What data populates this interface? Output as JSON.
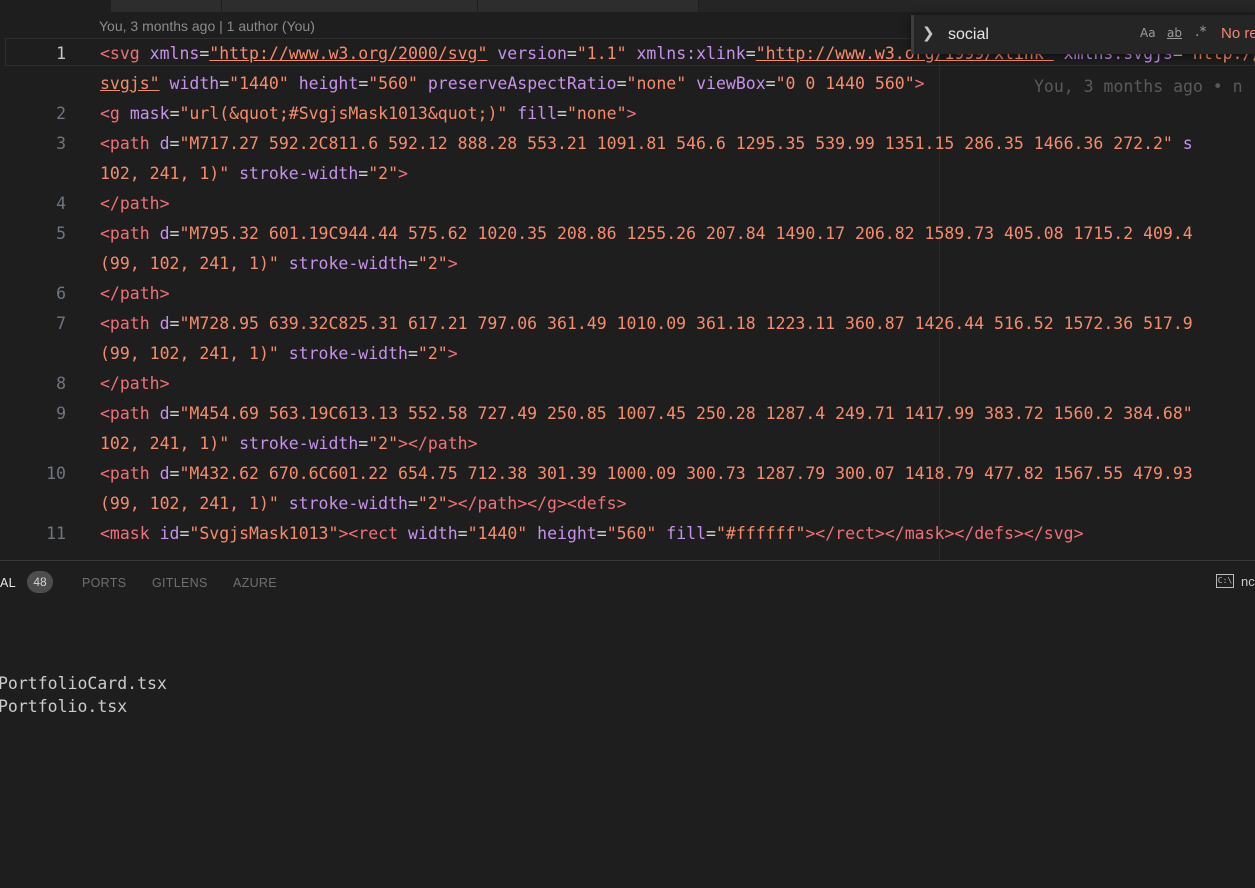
{
  "codelens": "You, 3 months ago | 1 author (You)",
  "blame": "You, 3 months ago • n",
  "line_numbers": [
    "1",
    "2",
    "3",
    "4",
    "5",
    "6",
    "7",
    "8",
    "9",
    "10",
    "11"
  ],
  "code": {
    "l1a": {
      "t1": "<svg ",
      "a1": "xmlns",
      "e1": "=",
      "s1": "\"http://www.w3.org/2000/svg\"",
      "a2": " version",
      "e2": "=",
      "s2": "\"1.1\"",
      "a3": " xmlns:xlink",
      "e3": "=",
      "s3": "\"http://www.w3.org/1999/xlink\"",
      "a4": " xmlns:svgjs",
      "e4": "=",
      "s4": "\"http://"
    },
    "l1b": {
      "s1": "svgjs\"",
      "a1": " width",
      "e1": "=",
      "s2": "\"1440\"",
      "a2": " height",
      "e2": "=",
      "s3": "\"560\"",
      "a3": " preserveAspectRatio",
      "e3": "=",
      "s4": "\"none\"",
      "a4": " viewBox",
      "e4": "=",
      "s5": "\"0 0 1440 560\"",
      "t1": ">"
    },
    "l2": {
      "t1": "<g ",
      "a1": "mask",
      "e1": "=",
      "s1": "\"url(&quot;#SvgjsMask1013&quot;)\"",
      "a2": " fill",
      "e2": "=",
      "s2": "\"none\"",
      "t2": ">"
    },
    "l3a": {
      "t1": "<path ",
      "a1": "d",
      "e1": "=",
      "s1": "\"M717.27 592.2C811.6 592.12 888.28 553.21 1091.81 546.6 1295.35 539.99 1351.15 286.35 1466.36 272.2\"",
      "a2": " s"
    },
    "l3b": {
      "s1": "102, 241, 1)\"",
      "a1": " stroke-width",
      "e1": "=",
      "s2": "\"2\"",
      "t1": ">"
    },
    "l4": {
      "t1": "</path>"
    },
    "l5a": {
      "t1": "<path ",
      "a1": "d",
      "e1": "=",
      "s1": "\"M795.32 601.19C944.44 575.62 1020.35 208.86 1255.26 207.84 1490.17 206.82 1589.73 405.08 1715.2 409.4"
    },
    "l5b": {
      "s1": "(99, 102, 241, 1)\"",
      "a1": " stroke-width",
      "e1": "=",
      "s2": "\"2\"",
      "t1": ">"
    },
    "l6": {
      "t1": "</path>"
    },
    "l7a": {
      "t1": "<path ",
      "a1": "d",
      "e1": "=",
      "s1": "\"M728.95 639.32C825.31 617.21 797.06 361.49 1010.09 361.18 1223.11 360.87 1426.44 516.52 1572.36 517.9"
    },
    "l7b": {
      "s1": "(99, 102, 241, 1)\"",
      "a1": " stroke-width",
      "e1": "=",
      "s2": "\"2\"",
      "t1": ">"
    },
    "l8": {
      "t1": "</path>"
    },
    "l9a": {
      "t1": "<path ",
      "a1": "d",
      "e1": "=",
      "s1": "\"M454.69 563.19C613.13 552.58 727.49 250.85 1007.45 250.28 1287.4 249.71 1417.99 383.72 1560.2 384.68\""
    },
    "l9b": {
      "s1": "102, 241, 1)\"",
      "a1": " stroke-width",
      "e1": "=",
      "s2": "\"2\"",
      "t1": "></path>"
    },
    "l10a": {
      "t1": "<path ",
      "a1": "d",
      "e1": "=",
      "s1": "\"M432.62 670.6C601.22 654.75 712.38 301.39 1000.09 300.73 1287.79 300.07 1418.79 477.82 1567.55 479.93"
    },
    "l10b": {
      "s1": "(99, 102, 241, 1)\"",
      "a1": " stroke-width",
      "e1": "=",
      "s2": "\"2\"",
      "t1": "></path></g><defs>"
    },
    "l11": {
      "t1": "<mask ",
      "a1": "id",
      "e1": "=",
      "s1": "\"SvgjsMask1013\"",
      "t2": "><rect ",
      "a2": "width",
      "e2": "=",
      "s2": "\"1440\"",
      "a3": " height",
      "e3": "=",
      "s3": "\"560\"",
      "a4": " fill",
      "e4": "=",
      "s4": "\"#ffffff\"",
      "t3": "></rect></mask></defs></svg>"
    }
  },
  "find": {
    "query": "social",
    "match_case": "Aa",
    "whole_word": "ab",
    "regex": ".*",
    "result": "No re"
  },
  "panel": {
    "tabs": [
      "AL",
      "PORTS",
      "GITLENS",
      "AZURE"
    ],
    "badge": "48",
    "terminal_label": "nc",
    "terminal_lines": [
      "PortfolioCard.tsx",
      "Portfolio.tsx"
    ]
  }
}
